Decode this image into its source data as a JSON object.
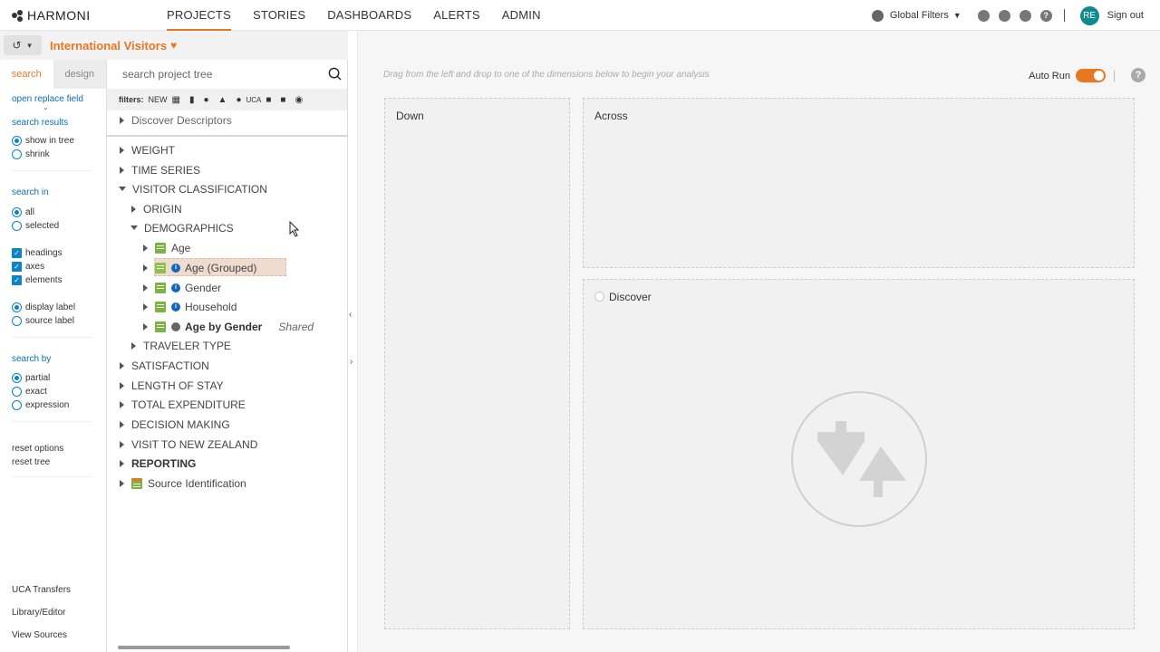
{
  "header": {
    "logo": "HARMONI",
    "nav": [
      "PROJECTS",
      "STORIES",
      "DASHBOARDS",
      "ALERTS",
      "ADMIN"
    ],
    "global_filters": "Global Filters",
    "avatar": "RE",
    "sign_out": "Sign out"
  },
  "project": {
    "title": "International Visitors"
  },
  "options": {
    "tabs": [
      "search",
      "design"
    ],
    "open_replace_field": "open replace field",
    "search_results_label": "search results",
    "search_results": [
      "show in tree",
      "shrink"
    ],
    "search_in_label": "search in",
    "search_in": [
      "all",
      "selected"
    ],
    "checks": [
      "headings",
      "axes",
      "elements"
    ],
    "labels": [
      "display label",
      "source label"
    ],
    "search_by_label": "search by",
    "search_by": [
      "partial",
      "exact",
      "expression"
    ],
    "reset_options": "reset options",
    "reset_tree": "reset tree",
    "bottom": [
      "UCA Transfers",
      "Library/Editor",
      "View Sources"
    ]
  },
  "tree": {
    "search_placeholder": "search project tree",
    "filters_label": "filters:",
    "filters_new": "NEW",
    "filters_uca": "UCA",
    "rows": [
      {
        "label": "Discover Descriptors"
      },
      {
        "label": "WEIGHT"
      },
      {
        "label": "TIME SERIES"
      },
      {
        "label": "VISITOR CLASSIFICATION"
      },
      {
        "label": "ORIGIN"
      },
      {
        "label": "DEMOGRAPHICS"
      },
      {
        "label": "Age"
      },
      {
        "label": "Age (Grouped)"
      },
      {
        "label": "Gender"
      },
      {
        "label": "Household"
      },
      {
        "label": "Age by Gender",
        "tag": "Shared"
      },
      {
        "label": "TRAVELER TYPE"
      },
      {
        "label": "SATISFACTION"
      },
      {
        "label": "LENGTH OF STAY"
      },
      {
        "label": "TOTAL EXPENDITURE"
      },
      {
        "label": "DECISION MAKING"
      },
      {
        "label": "VISIT TO NEW ZEALAND"
      },
      {
        "label": "REPORTING"
      },
      {
        "label": "Source Identification"
      }
    ]
  },
  "workspace": {
    "hint": "Drag from the left and drop to one of the dimensions below to begin your analysis",
    "auto_run": "Auto Run",
    "auto_run_on": true,
    "zones": [
      "Down",
      "Across",
      "Discover"
    ]
  }
}
